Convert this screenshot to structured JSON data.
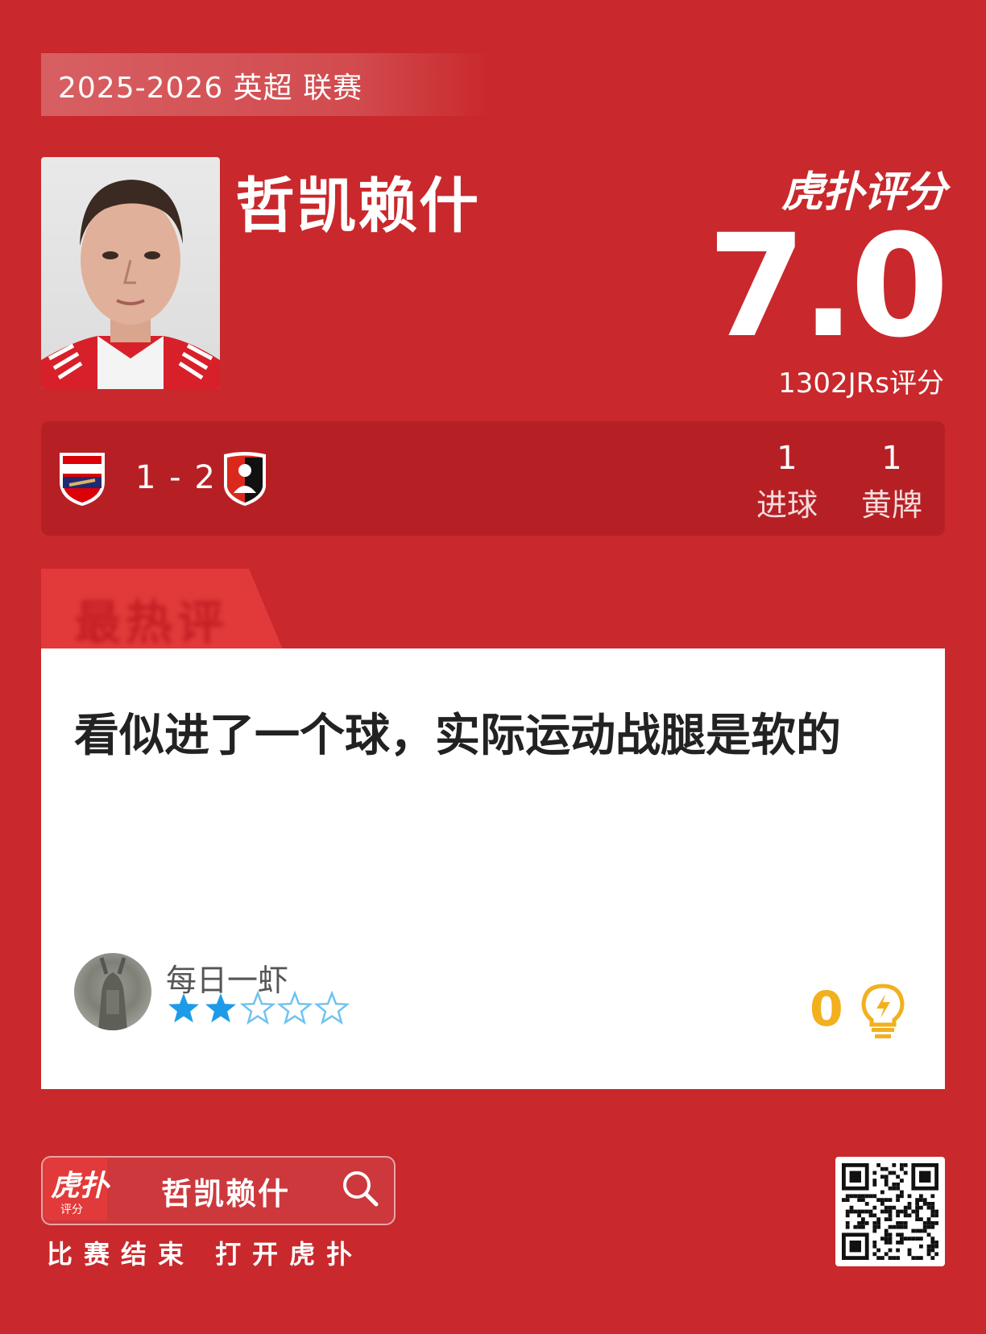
{
  "season_label": "2025-2026 英超 联赛",
  "player": {
    "name": "哲凯赖什"
  },
  "rating": {
    "brand": "虎扑评分",
    "score": "7.0",
    "count_label": "1302JRs评分"
  },
  "match": {
    "home_team": "Arsenal",
    "away_team": "AFC Bournemouth",
    "score": "1 - 2",
    "stats": [
      {
        "value": "1",
        "label": "进球"
      },
      {
        "value": "1",
        "label": "黄牌"
      }
    ]
  },
  "comment": {
    "tab_label": "最热评",
    "text": "看似进了一个球，实际运动战腿是软的",
    "user": "每日一虾",
    "stars": 2,
    "stars_max": 5,
    "likes": "0"
  },
  "footer": {
    "app_icon_top": "虎扑",
    "app_icon_bottom": "评分",
    "search_text": "哲凯赖什",
    "caption": "比赛结束 打开虎扑"
  },
  "colors": {
    "background": "#c9282c",
    "panel": "#b62025",
    "accent": "#e23a3a",
    "star": "#1e9be8",
    "like": "#f2b01e"
  }
}
